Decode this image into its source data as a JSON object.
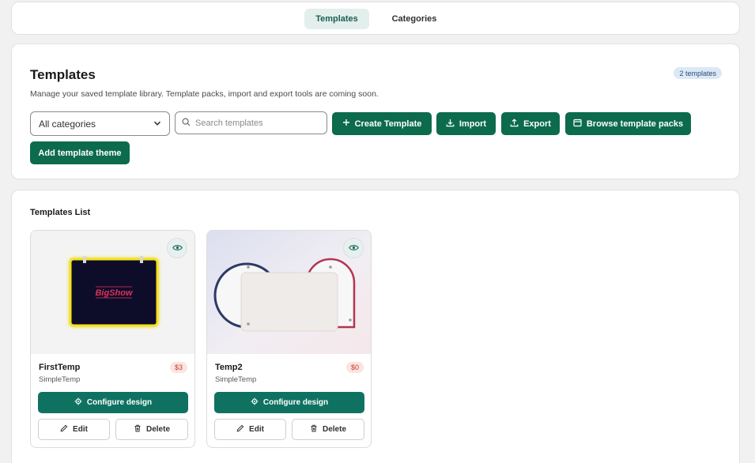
{
  "tabs": [
    {
      "label": "Templates",
      "active": true
    },
    {
      "label": "Categories",
      "active": false
    }
  ],
  "header": {
    "title": "Templates",
    "description": "Manage your saved template library. Template packs, import and export tools are coming soon.",
    "count_badge": "2 templates"
  },
  "filters": {
    "category_selected": "All categories",
    "search_placeholder": "Search templates"
  },
  "actions": {
    "create": "Create Template",
    "import": "Import",
    "export": "Export",
    "packs": "Browse template packs",
    "theme": "Add template theme"
  },
  "list": {
    "title": "Templates List",
    "items": [
      {
        "name": "FirstTemp",
        "subtitle": "SimpleTemp",
        "price": "$3",
        "thumb_text": "BigShow",
        "configure": "Configure design",
        "edit": "Edit",
        "delete": "Delete"
      },
      {
        "name": "Temp2",
        "subtitle": "SimpleTemp",
        "price": "$0",
        "configure": "Configure design",
        "edit": "Edit",
        "delete": "Delete"
      }
    ]
  },
  "colors": {
    "primary": "#0c6b4d",
    "primary_teal": "#0f7261",
    "tab_active_bg": "#e3efec",
    "badge_bg": "#dce8f5",
    "price_bg": "#fbe4e1",
    "price_text": "#c2402f"
  },
  "icons": {
    "select": "chevron-down-icon",
    "search": "search-icon",
    "create": "plus-icon",
    "import": "download-icon",
    "export": "upload-icon",
    "packs": "window-icon",
    "preview": "eye-icon",
    "configure": "gear-icon",
    "edit": "pencil-icon",
    "delete": "trash-icon"
  }
}
